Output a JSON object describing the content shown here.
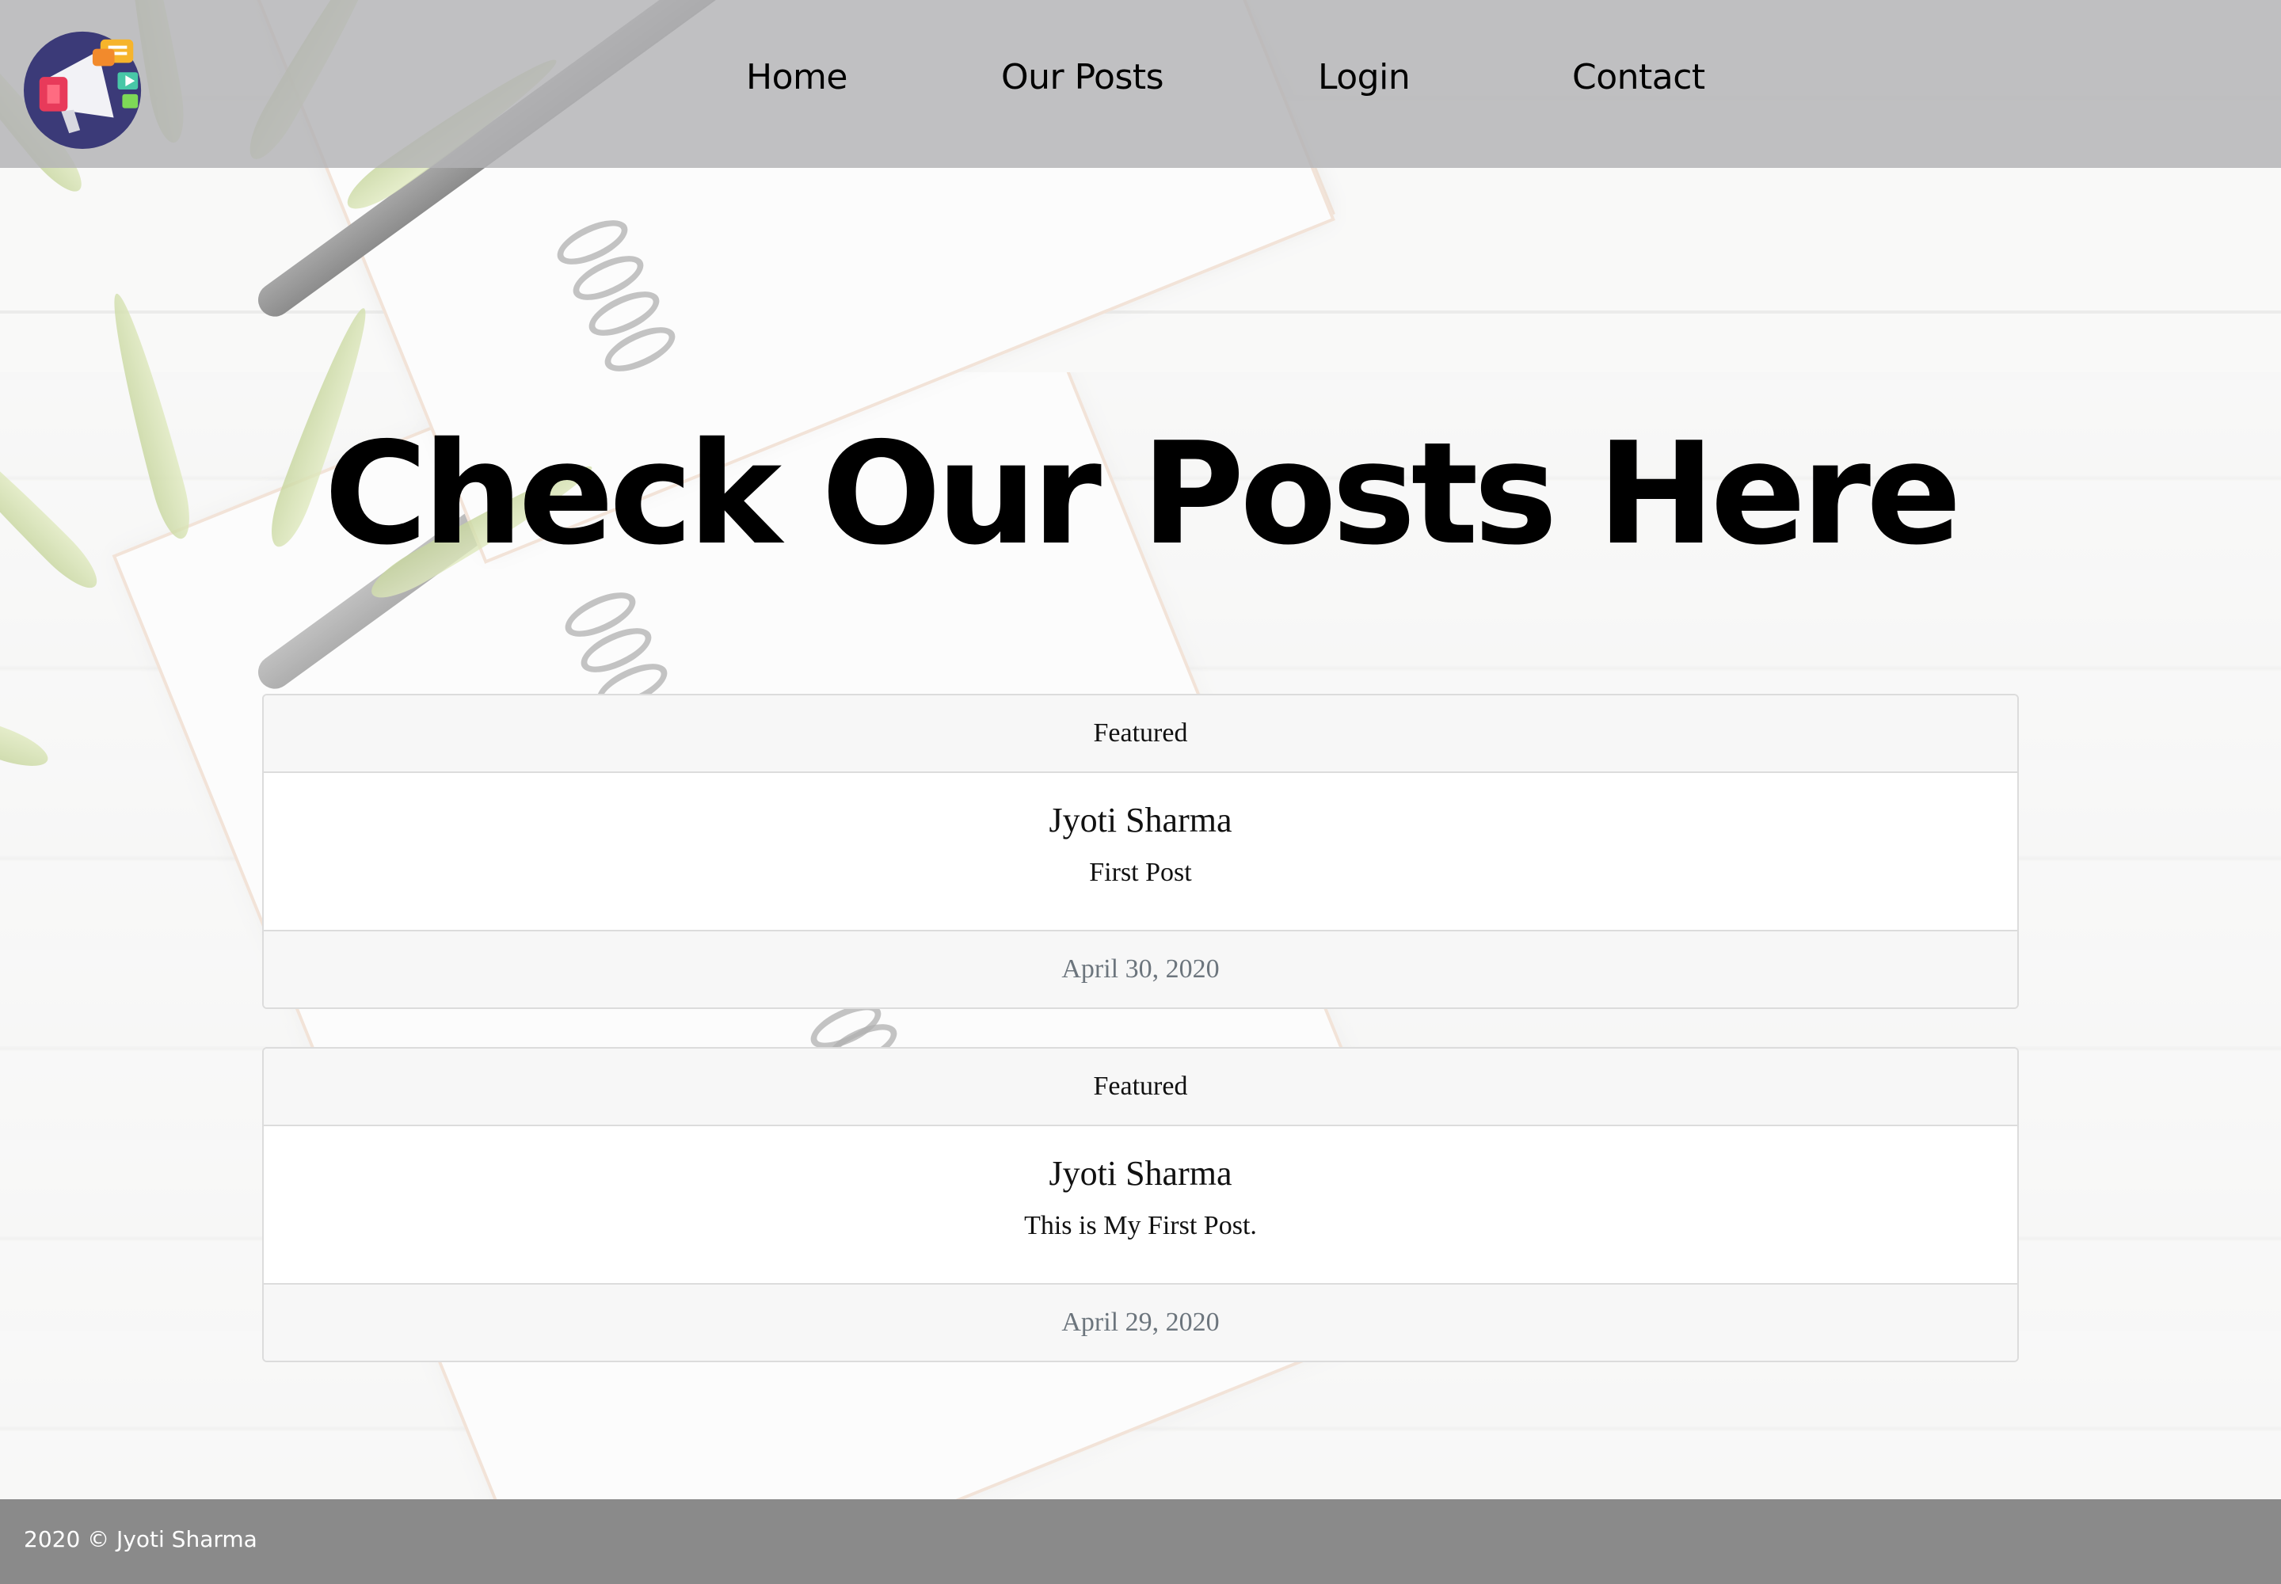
{
  "nav": {
    "items": [
      "Home",
      "Our Posts",
      "Login",
      "Contact"
    ]
  },
  "hero": {
    "title": "Check Our Posts Here"
  },
  "posts": [
    {
      "badge": "Featured",
      "author": "Jyoti Sharma",
      "text": "First Post",
      "date": "April 30, 2020"
    },
    {
      "badge": "Featured",
      "author": "Jyoti Sharma",
      "text": "This is My First Post.",
      "date": "April 29, 2020"
    }
  ],
  "footer": {
    "copyright": "2020 © Jyoti Sharma"
  },
  "colors": {
    "header_bg": "#b2b2b4",
    "footer_bg": "#8a8a8a",
    "card_header_bg": "#f7f7f7",
    "muted_text": "#6c757d"
  },
  "icons": {
    "logo": "megaphone-logo-icon"
  }
}
